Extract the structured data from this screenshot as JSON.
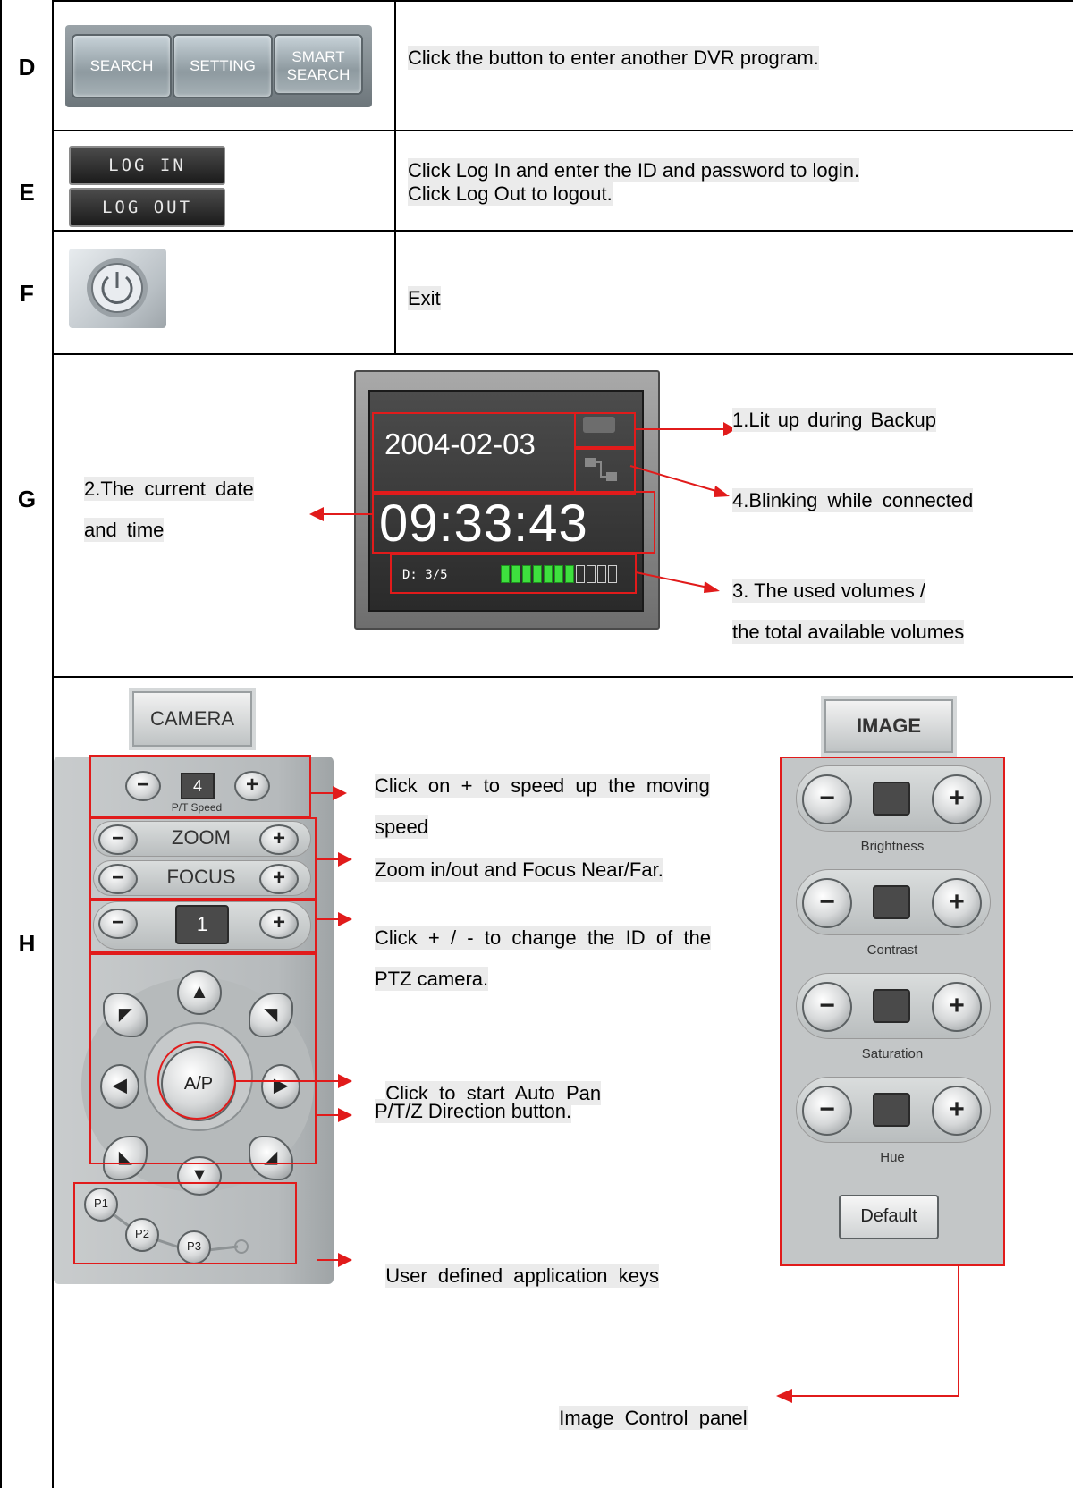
{
  "rows": {
    "D": {
      "label": "D",
      "buttons": [
        "SEARCH",
        "SETTING",
        "SMART SEARCH"
      ],
      "description": "Click the button to enter another DVR program."
    },
    "E": {
      "label": "E",
      "buttons": [
        "LOG IN",
        "LOG OUT"
      ],
      "description_line1": "Click Log In and enter the ID and password to login.",
      "description_line2": "Click Log Out to logout."
    },
    "F": {
      "label": "F",
      "icon": "power-icon",
      "description": "Exit"
    },
    "G": {
      "label": "G",
      "date": "2004-02-03",
      "time": "09:33:43",
      "volume_label": "D: 3/5",
      "volume_level": {
        "lit": 7,
        "total": 11
      },
      "annotations": {
        "backup": "1.Lit up during Backup",
        "datetime_line1": "2.The current date",
        "datetime_line2": "and time",
        "volumes_line1": "3. The used volumes /",
        "volumes_line2": "the total available volumes",
        "connected": "4.Blinking while connected"
      }
    },
    "H": {
      "label": "H",
      "camera_tab": "CAMERA",
      "image_tab": "IMAGE",
      "pt_speed_value": "4",
      "pt_speed_label": "P/T Speed",
      "zoom_label": "ZOOM",
      "focus_label": "FOCUS",
      "camera_id": "1",
      "autopan_label": "A/P",
      "preset_keys": [
        "P1",
        "P2",
        "P3"
      ],
      "image_controls": [
        "Brightness",
        "Contrast",
        "Saturation",
        "Hue"
      ],
      "default_button": "Default",
      "annotations": {
        "speed_line1": "Click  on  +  to  speed  up  the  moving",
        "speed_line2": "speed",
        "zoom_focus": "Zoom in/out and Focus Near/Far.",
        "id_line1": "Click  +  /  -  to  change  the  ID  of  the",
        "id_line2": "PTZ camera.",
        "autopan": "Click  to  start  Auto  Pan",
        "direction": "P/T/Z Direction button.",
        "user_keys": "User  defined  application  keys",
        "image_panel": "Image  Control  panel"
      }
    }
  },
  "colors": {
    "annotation_red": "#e11b1b",
    "highlight_gray": "#ebebeb",
    "volume_green": "#3ee03e"
  }
}
